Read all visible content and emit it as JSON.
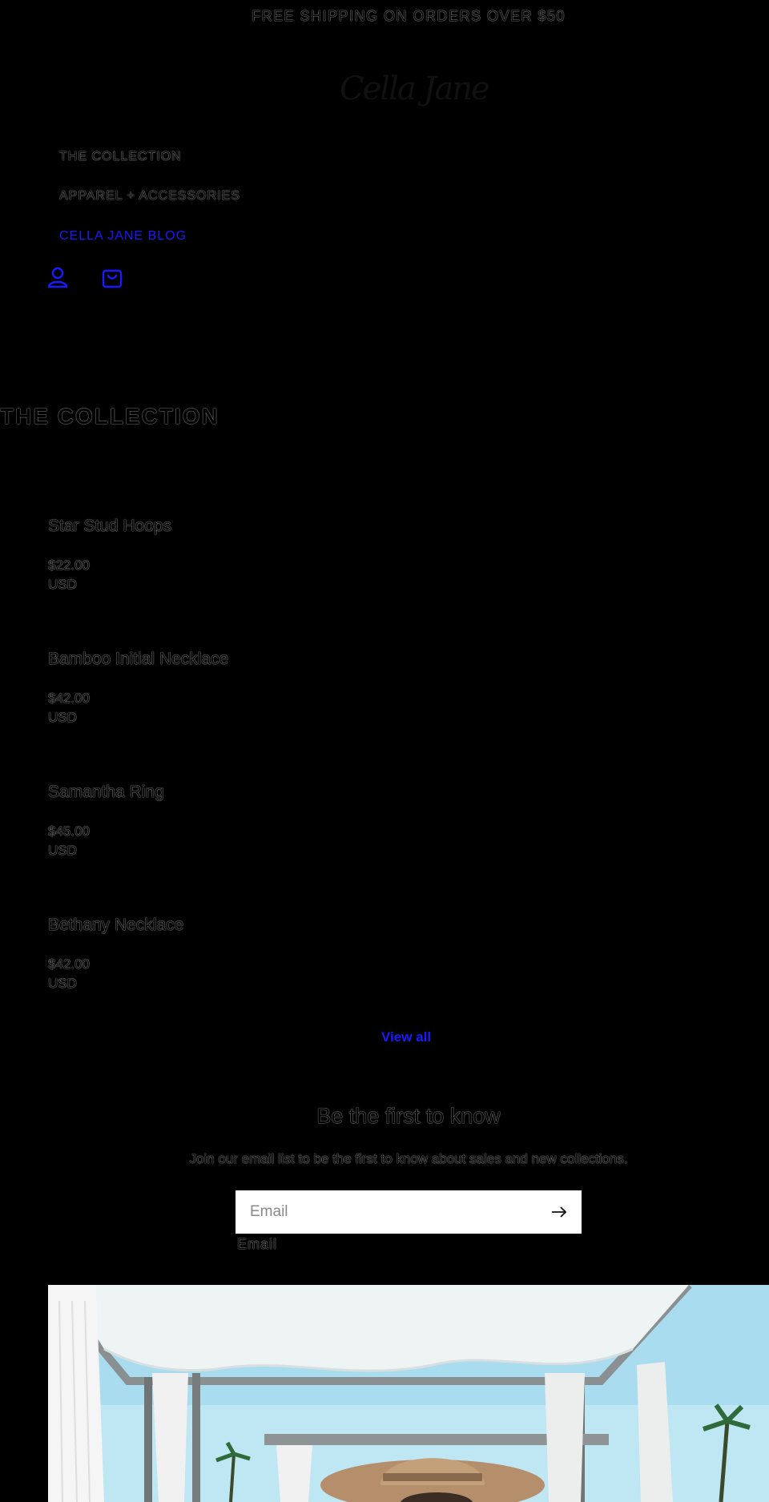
{
  "announcement": "FREE SHIPPING ON ORDERS OVER $50",
  "brand": {
    "logo_text": "Cella Jane"
  },
  "nav": {
    "items": [
      {
        "label": "THE COLLECTION"
      },
      {
        "label": "APPAREL + ACCESSORIES"
      },
      {
        "label": "CELLA JANE BLOG"
      }
    ],
    "icons": [
      "account-icon",
      "cart-icon"
    ]
  },
  "collection": {
    "title": "THE COLLECTION",
    "products": [
      {
        "name": "Star Stud Hoops",
        "price": "$22.00",
        "currency": "USD"
      },
      {
        "name": "Bamboo Initial Necklace",
        "price": "$42.00",
        "currency": "USD"
      },
      {
        "name": "Samantha Ring",
        "price": "$45.00",
        "currency": "USD"
      },
      {
        "name": "Bethany Necklace",
        "price": "$42.00",
        "currency": "USD"
      }
    ],
    "view_all": "View all"
  },
  "newsletter": {
    "title": "Be the first to know",
    "subtitle": "Join our email list to be the first to know about sales and new collections.",
    "placeholder": "Email",
    "label": "Email"
  },
  "colors": {
    "background": "#000000",
    "link": "#1a1aff",
    "input_bg": "#ffffff"
  }
}
